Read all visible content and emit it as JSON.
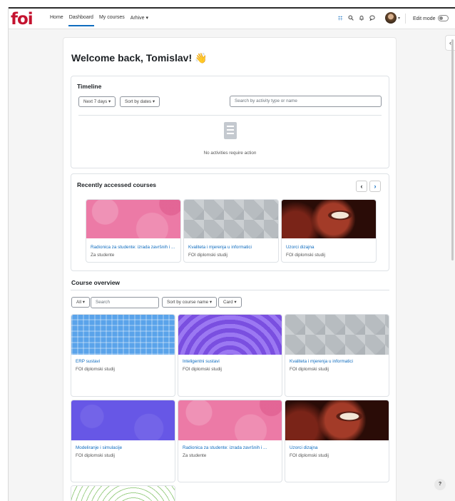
{
  "topbar": {
    "logo": "foi",
    "nav": [
      "Home",
      "Dashboard",
      "My courses",
      "Arhive ▾"
    ],
    "icons": [
      "apps-grid-icon",
      "search-icon",
      "bell-icon",
      "chat-icon"
    ],
    "edit_mode_label": "Edit mode"
  },
  "page": {
    "welcome": "Welcome back, Tomislav! 👋"
  },
  "timeline": {
    "heading": "Timeline",
    "range_label": "Next 7 days ▾",
    "sort_label": "Sort by dates ▾",
    "search_placeholder": "Search by activity type or name",
    "empty_text": "No activities require action"
  },
  "recent": {
    "heading": "Recently accessed courses",
    "prev": "‹",
    "next": "›",
    "courses": [
      {
        "title": "Radionica za studente: izrada završnih i ...",
        "category": "Za studente",
        "pattern": "pink"
      },
      {
        "title": "Kvaliteta i mjerenja u informatici",
        "category": "FOI diplomski studij",
        "pattern": "grey"
      },
      {
        "title": "Uzorci dizajna",
        "category": "FOI diplomski studij",
        "pattern": "coral"
      }
    ]
  },
  "overview": {
    "heading": "Course overview",
    "filter_label": "All ▾",
    "search_placeholder": "Search",
    "sort_label": "Sort by course name ▾",
    "view_label": "Card ▾",
    "courses": [
      {
        "title": "ERP sustavi",
        "category": "FOI diplomski studij",
        "pattern": "plaid"
      },
      {
        "title": "Inteligentni sustavi",
        "category": "FOI diplomski studij",
        "pattern": "waves"
      },
      {
        "title": "Kvaliteta i mjerenja u informatici",
        "category": "FOI diplomski studij",
        "pattern": "grey"
      },
      {
        "title": "Modeliranje i simulacije",
        "category": "FOI diplomski studij",
        "pattern": "hex"
      },
      {
        "title": "Radionica za studente: izrada završnih i ...",
        "category": "Za studente",
        "pattern": "pink"
      },
      {
        "title": "Uzorci dizajna",
        "category": "FOI diplomski studij",
        "pattern": "coral"
      },
      {
        "title": "",
        "category": "",
        "pattern": "swirl"
      }
    ]
  },
  "help_label": "?",
  "colors": {
    "brand": "#c4122f",
    "link": "#0f6cbf"
  }
}
